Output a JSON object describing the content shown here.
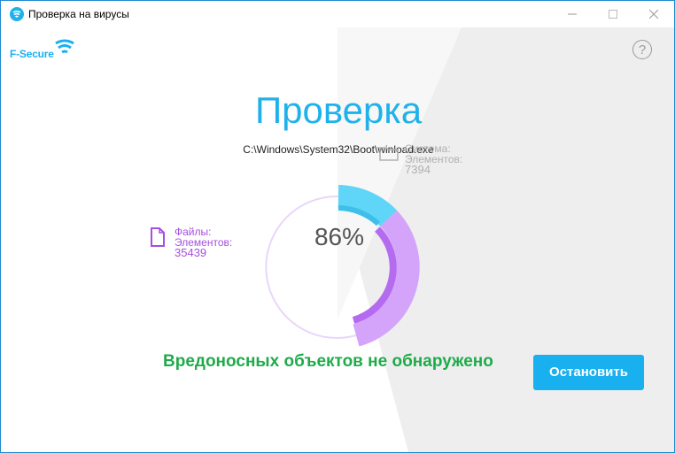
{
  "window": {
    "title": "Проверка на вирусы"
  },
  "brand": {
    "logo_text": "F-Secure",
    "accent_color": "#1fb2ea"
  },
  "help": {
    "label": "?"
  },
  "scan": {
    "heading": "Проверка",
    "current_file": "C:\\Windows\\System32\\Boot\\winload.exe",
    "progress_label": "86%",
    "progress_fraction": 0.86
  },
  "system": {
    "label": "Система:",
    "items_label": "Элементов:",
    "count": "7394",
    "color": "#5fd0f5"
  },
  "files": {
    "label": "Файлы:",
    "items_label": "Элементов:",
    "count": "35439",
    "color": "#b06ee8"
  },
  "status_text": "Вредоносных объектов не обнаружено",
  "status_color": "#1fab4a",
  "stop_button": {
    "label": "Остановить"
  },
  "icons": {
    "app": "fsecure-shield-icon",
    "minimize": "minimize-icon",
    "maximize": "maximize-icon",
    "close": "close-icon",
    "help": "question-icon",
    "system": "folder-icon",
    "files": "file-icon"
  }
}
